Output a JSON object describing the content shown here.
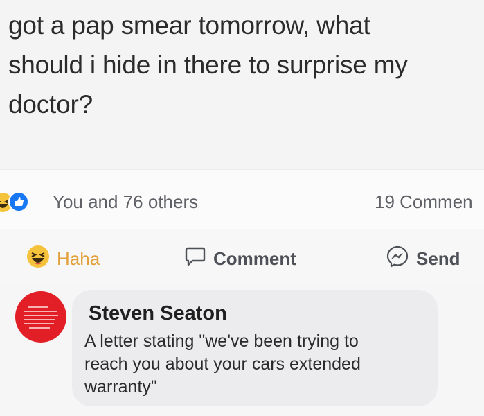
{
  "post": {
    "text_lines": [
      "got a pap smear tomorrow, what",
      "should i hide in there to surprise my",
      "doctor?"
    ]
  },
  "reactions": {
    "icons": [
      "haha-reaction-icon",
      "like-reaction-icon"
    ],
    "summary": "You and 76 others",
    "comments_count": "19 Commen"
  },
  "actions": {
    "haha_label": "Haha",
    "comment_label": "Comment",
    "send_label": "Send"
  },
  "comment": {
    "author": "Steven Seaton",
    "text_lines": [
      "A letter stating \"we've been trying to",
      "reach you about your cars extended",
      "warranty\""
    ]
  },
  "colors": {
    "haha_accent": "#e3a13b",
    "like_blue": "#1877f2",
    "avatar_red": "#e21f26"
  }
}
